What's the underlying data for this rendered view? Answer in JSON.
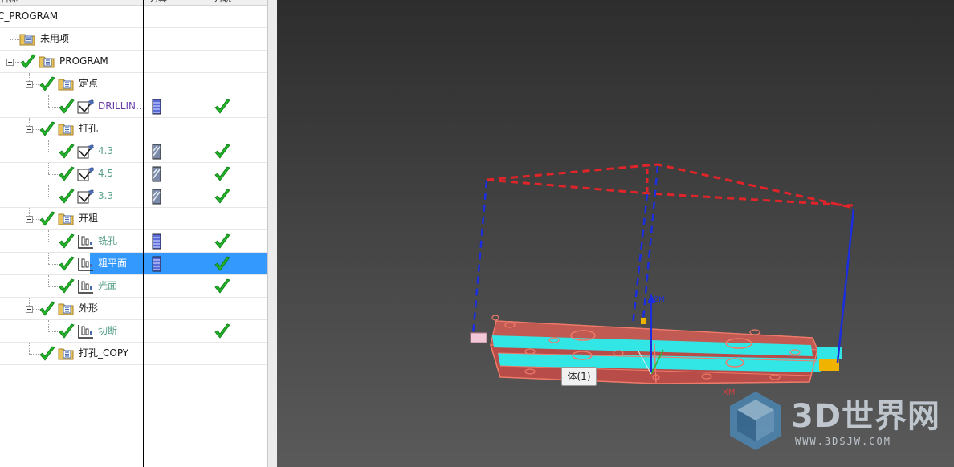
{
  "navigator": {
    "columns": {
      "name": "名称",
      "tool": "刀具",
      "path": "刀轨"
    },
    "rows": [
      {
        "label": "NC_PROGRAM",
        "status_check": false
      },
      {
        "label": "未用项",
        "status_check": false
      },
      {
        "label": "PROGRAM",
        "status_check": true
      },
      {
        "label": "定点",
        "status_check": true
      },
      {
        "label": "DRILLIN...",
        "status_check": true,
        "tool_icon": "drill-tool-icon",
        "path_check": true
      },
      {
        "label": "打孔",
        "status_check": true
      },
      {
        "label": "4.3",
        "status_check": true,
        "tool_icon": "drill-bit-icon",
        "path_check": true
      },
      {
        "label": "4.5",
        "status_check": true,
        "tool_icon": "drill-bit-icon",
        "path_check": true
      },
      {
        "label": "3.3",
        "status_check": true,
        "tool_icon": "drill-bit-icon",
        "path_check": true
      },
      {
        "label": "开粗",
        "status_check": true
      },
      {
        "label": "铣孔",
        "status_check": true,
        "tool_icon": "mill-tool-icon",
        "path_check": true
      },
      {
        "label": "粗平面",
        "status_check": true,
        "tool_icon": "mill-tool-icon",
        "path_check": true,
        "selected": true
      },
      {
        "label": "光面",
        "status_check": true,
        "path_check": true
      },
      {
        "label": "外形",
        "status_check": true
      },
      {
        "label": "切断",
        "status_check": true,
        "path_check": true
      },
      {
        "label": "打孔_COPY",
        "status_check": true
      }
    ]
  },
  "viewport": {
    "tooltip": "体(1)",
    "axis_label": "XM",
    "watermark": {
      "brand": "3D世界网",
      "url": "WWW.3DSJW.COM"
    }
  },
  "colors": {
    "check_green": "#22b32a",
    "selection": "#3399ff",
    "toolpath_red": "#e0242a",
    "toolpath_blue": "#1a2ee0",
    "part_cyan": "#33e6e6",
    "part_edge": "#e06858"
  }
}
